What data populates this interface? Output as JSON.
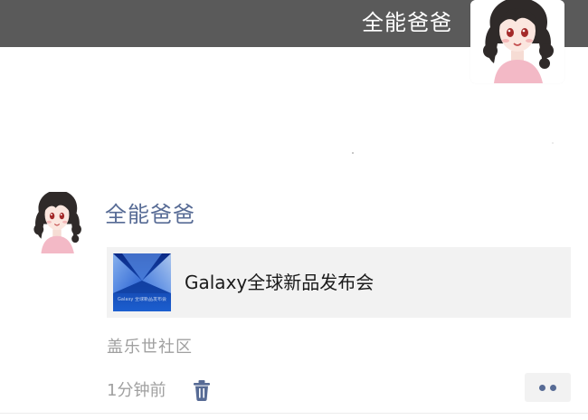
{
  "header": {
    "name": "全能爸爸",
    "band_color": "#5a5a5a",
    "avatar_icon": "cartoon-girl-avatar"
  },
  "post": {
    "username": "全能爸爸",
    "username_color": "#576b95",
    "avatar_icon": "cartoon-girl-avatar",
    "share": {
      "title": "Galaxy全球新品发布会",
      "thumbnail_icon": "galaxy-launch-thumbnail",
      "thumbnail_caption": "Galaxy 全球新品发布会",
      "background_color": "#f2f2f2"
    },
    "community": "盖乐世社区",
    "time": "1分钟前",
    "delete_icon": "trash-icon",
    "more_icon": "more-dots-icon"
  }
}
